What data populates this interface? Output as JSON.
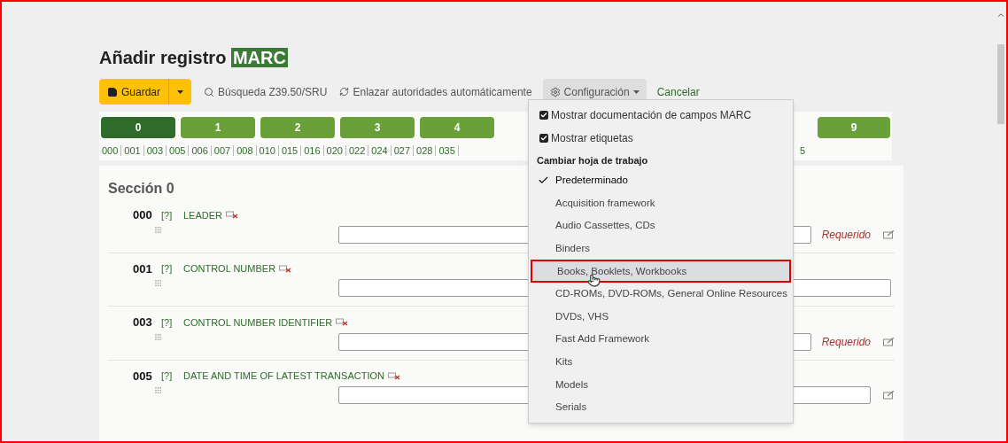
{
  "title": {
    "text": "Añadir registro",
    "highlight": "MARC"
  },
  "toolbar": {
    "save": "Guardar",
    "search": "Búsqueda Z39.50/SRU",
    "link_authorities": "Enlazar autoridades automáticamente",
    "settings": "Configuración",
    "cancel": "Cancelar"
  },
  "tabs": [
    {
      "label": "0",
      "selected": true
    },
    {
      "label": "1",
      "selected": false
    },
    {
      "label": "2",
      "selected": false
    },
    {
      "label": "3",
      "selected": false
    },
    {
      "label": "4",
      "selected": false
    },
    {
      "label": "9",
      "selected": false
    }
  ],
  "tags": [
    "000",
    "001",
    "003",
    "005",
    "006",
    "007",
    "008",
    "010",
    "015",
    "016",
    "020",
    "022",
    "024",
    "027",
    "028",
    "035"
  ],
  "tags_tail": "5",
  "section": {
    "title": "Sección 0",
    "fields": [
      {
        "tag": "000",
        "help": "[?]",
        "label": "LEADER",
        "required": true,
        "editor_icon": true,
        "required_text": "Requerido"
      },
      {
        "tag": "001",
        "help": "[?]",
        "label": "CONTROL NUMBER",
        "required": false,
        "editor_icon": false
      },
      {
        "tag": "003",
        "help": "[?]",
        "label": "CONTROL NUMBER IDENTIFIER",
        "required": true,
        "editor_icon": true,
        "required_text": "Requerido"
      },
      {
        "tag": "005",
        "help": "[?]",
        "label": "DATE AND TIME OF LATEST TRANSACTION",
        "required": false,
        "editor_icon": true
      }
    ]
  },
  "menu": {
    "options": [
      {
        "label": "Mostrar documentación de campos MARC",
        "checked": true
      },
      {
        "label": "Mostrar etiquetas",
        "checked": true
      }
    ],
    "header": "Cambiar hoja de trabajo",
    "frameworks": [
      {
        "label": "Predeterminado",
        "selected": true,
        "highlighted": false
      },
      {
        "label": "Acquisition framework",
        "selected": false,
        "highlighted": false
      },
      {
        "label": "Audio Cassettes, CDs",
        "selected": false,
        "highlighted": false
      },
      {
        "label": "Binders",
        "selected": false,
        "highlighted": false
      },
      {
        "label": "Books, Booklets, Workbooks",
        "selected": false,
        "highlighted": true
      },
      {
        "label": "CD-ROMs, DVD-ROMs, General Online Resources",
        "selected": false,
        "highlighted": false
      },
      {
        "label": "DVDs, VHS",
        "selected": false,
        "highlighted": false
      },
      {
        "label": "Fast Add Framework",
        "selected": false,
        "highlighted": false
      },
      {
        "label": "Kits",
        "selected": false,
        "highlighted": false
      },
      {
        "label": "Models",
        "selected": false,
        "highlighted": false
      },
      {
        "label": "Serials",
        "selected": false,
        "highlighted": false
      }
    ]
  }
}
